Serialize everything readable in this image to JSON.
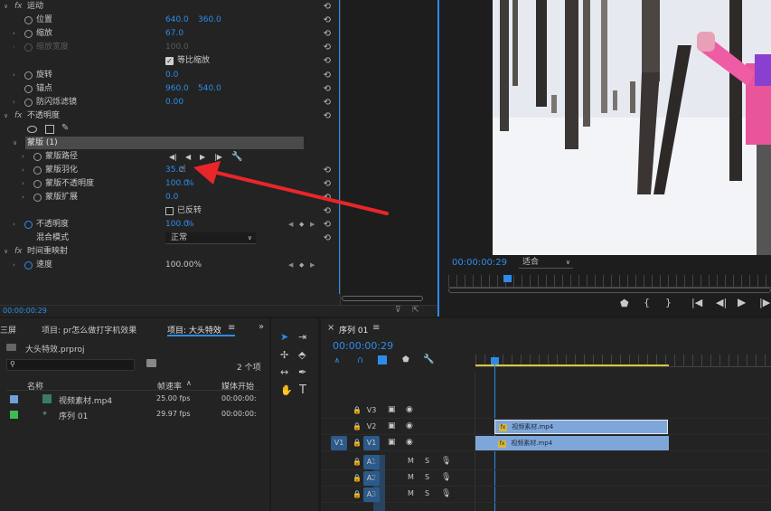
{
  "effect_controls": {
    "motion": {
      "fx": "fx",
      "name": "运动"
    },
    "position": {
      "name": "位置",
      "x": "640.0",
      "y": "360.0"
    },
    "scale": {
      "name": "缩放",
      "value": "67.0"
    },
    "scale_width": {
      "name": "缩放宽度",
      "value": "100.0"
    },
    "uniform_scale": {
      "name": "等比缩放"
    },
    "rotation": {
      "name": "旋转",
      "value": "0.0"
    },
    "anchor": {
      "name": "锚点",
      "x": "960.0",
      "y": "540.0"
    },
    "antiflicker": {
      "name": "防闪烁滤镜",
      "value": "0.00"
    },
    "opacity_section": {
      "fx": "fx",
      "name": "不透明度"
    },
    "mask": {
      "name": "蒙版 (1)"
    },
    "mask_path": {
      "name": "蒙版路径"
    },
    "mask_feather": {
      "name": "蒙版羽化",
      "value": "35.0"
    },
    "mask_opacity": {
      "name": "蒙版不透明度",
      "value": "100.0",
      "unit": "%"
    },
    "mask_expansion": {
      "name": "蒙版扩展",
      "value": "0.0"
    },
    "inverted": {
      "name": "已反转"
    },
    "opacity": {
      "name": "不透明度",
      "value": "100.0",
      "unit": "%"
    },
    "blend_mode": {
      "name": "混合模式",
      "value": "正常"
    },
    "time_remap": {
      "fx": "fx",
      "name": "时间重映射"
    },
    "speed": {
      "name": "速度",
      "value": "100.00%"
    },
    "timecode": "00:00:00:29"
  },
  "program_monitor": {
    "timecode": "00:00:00:29",
    "fit_label": "适合",
    "transport": [
      "marker-icon",
      "in-icon",
      "out-icon",
      "goto-in-icon",
      "step-back-icon",
      "play-icon",
      "step-fwd-icon"
    ]
  },
  "project_panel": {
    "tab_left": "三屏",
    "tab1": "项目: pr怎么做打字机效果",
    "tab2": "项目: 大头特效",
    "menu": "≡",
    "more": "»",
    "project_file": "大头特效.prproj",
    "item_count": "2 个项",
    "col_name": "名称",
    "col_fps": "帧速率",
    "col_start": "媒体开始",
    "rows": [
      {
        "name": "视频素材.mp4",
        "fps": "25.00 fps",
        "start": "00:00:00:",
        "color": "#6fa0d8"
      },
      {
        "name": "序列 01",
        "fps": "29.97 fps",
        "start": "00:00:00:",
        "color": "#3dbb55"
      }
    ]
  },
  "timeline": {
    "close": "×",
    "tab": "序列 01",
    "menu": "≡",
    "timecode": "00:00:00:29",
    "tracks_video": [
      "V3",
      "V2",
      "V1"
    ],
    "tracks_audio": [
      "A1",
      "A2",
      "A3"
    ],
    "source_v": "V1",
    "clip_v2": "视频素材.mp4",
    "clip_v1": "视频素材.mp4",
    "fx_badge": "fx"
  },
  "colors": {
    "accent": "#2d8ceb",
    "arrow": "#e8262a",
    "clip": "#7fa6d8"
  }
}
